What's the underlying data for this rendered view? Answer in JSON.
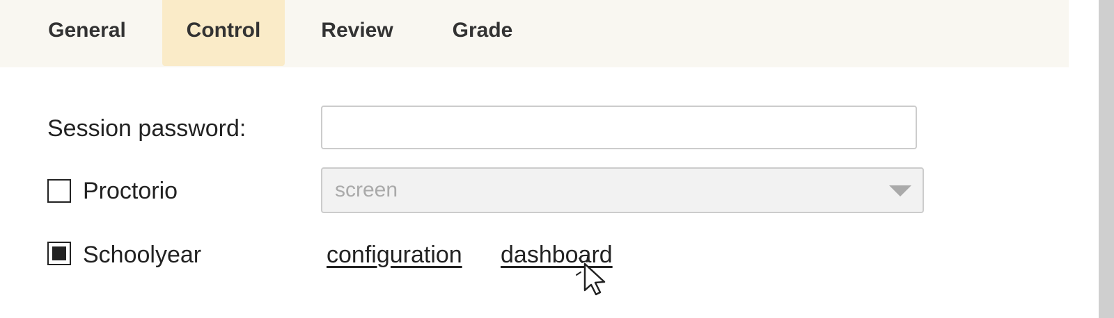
{
  "tabs": [
    {
      "label": "General",
      "active": false
    },
    {
      "label": "Control",
      "active": true
    },
    {
      "label": "Review",
      "active": false
    },
    {
      "label": "Grade",
      "active": false
    }
  ],
  "form": {
    "session_password": {
      "label": "Session password:",
      "value": ""
    },
    "proctorio": {
      "label": "Proctorio",
      "checked": false,
      "select_value": "screen"
    },
    "schoolyear": {
      "label": "Schoolyear",
      "checked": true,
      "links": {
        "configuration": "configuration",
        "dashboard": "dashboard"
      }
    }
  },
  "colors": {
    "tabbar_bg": "#f9f7f1",
    "active_tab_bg": "#faebc8",
    "text": "#222222",
    "disabled_text": "#aaaaaa"
  },
  "icons": {
    "select_arrow": "chevron-down-icon",
    "cursor": "pointer-cursor-icon"
  }
}
